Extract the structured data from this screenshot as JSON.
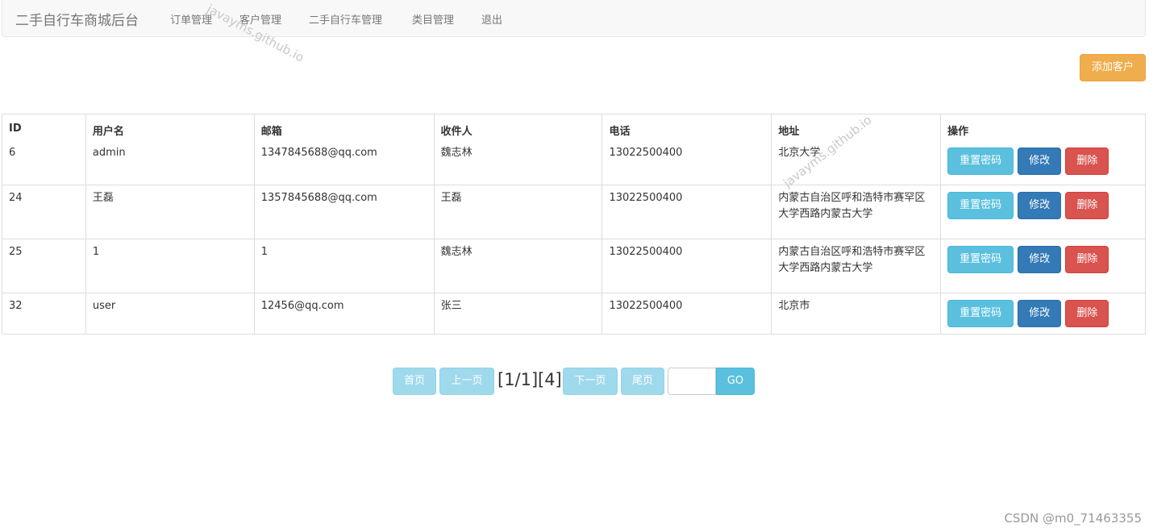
{
  "navbar": {
    "brand": "二手自行车商城后台",
    "items": [
      "订单管理",
      "客户管理",
      "二手自行车管理",
      "类目管理",
      "退出"
    ]
  },
  "toolbar": {
    "add_customer_label": "添加客户"
  },
  "table": {
    "columns": [
      "ID",
      "用户名",
      "邮箱",
      "收件人",
      "电话",
      "地址",
      "操作"
    ],
    "rows": [
      {
        "id": "6",
        "username": "admin",
        "email": "1347845688@qq.com",
        "recipient": "魏志林",
        "phone": "13022500400",
        "address": "北京大学"
      },
      {
        "id": "24",
        "username": "王磊",
        "email": "1357845688@qq.com",
        "recipient": "王磊",
        "phone": "13022500400",
        "address": "内蒙古自治区呼和浩特市赛罕区大学西路内蒙古大学"
      },
      {
        "id": "25",
        "username": "1",
        "email": "1",
        "recipient": "魏志林",
        "phone": "13022500400",
        "address": "内蒙古自治区呼和浩特市赛罕区大学西路内蒙古大学"
      },
      {
        "id": "32",
        "username": "user",
        "email": "12456@qq.com",
        "recipient": "张三",
        "phone": "13022500400",
        "address": "北京市"
      }
    ],
    "actions": {
      "reset_password": "重置密码",
      "edit": "修改",
      "delete": "删除"
    }
  },
  "pagination": {
    "first": "首页",
    "prev": "上一页",
    "page_info": "[1/1]",
    "total_info": "[4]",
    "next": "下一页",
    "last": "尾页",
    "page_input_value": "",
    "go": "GO"
  },
  "watermark": "javayms.github.io",
  "footer_credit": "CSDN @m0_71463355",
  "colors": {
    "warning": "#f0ad4e",
    "info": "#5bc0de",
    "primary": "#337ab7",
    "danger": "#d9534f",
    "navbar_bg": "#f8f8f8"
  }
}
